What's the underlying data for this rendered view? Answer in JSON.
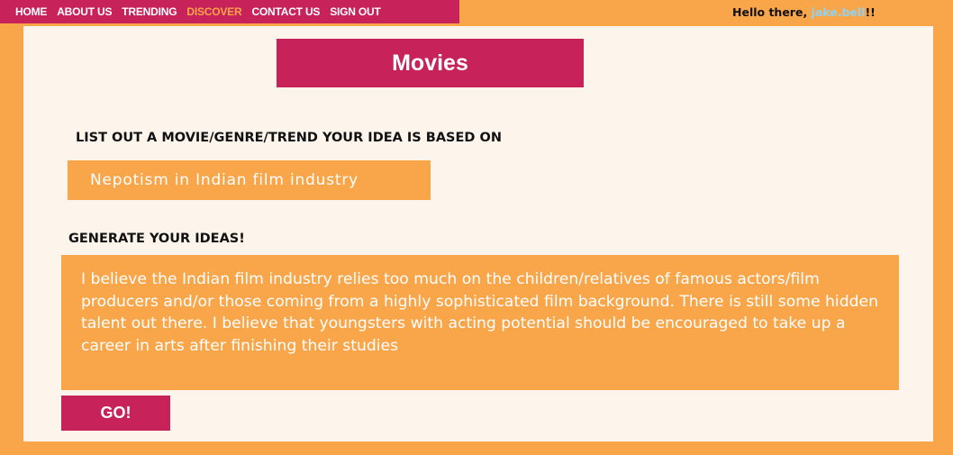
{
  "nav": {
    "items": [
      {
        "label": "HOME"
      },
      {
        "label": "ABOUT US"
      },
      {
        "label": "TRENDING"
      },
      {
        "label": "DISCOVER",
        "active": true
      },
      {
        "label": "CONTACT US"
      },
      {
        "label": "SIGN OUT"
      }
    ]
  },
  "greeting": {
    "prefix": "Hello there, ",
    "username": "jake.bell",
    "suffix": "!!"
  },
  "page": {
    "title": "Movies"
  },
  "form": {
    "basis_label": "LIST OUT A MOVIE/GENRE/TREND YOUR IDEA IS BASED ON",
    "basis_value": "Nepotism in Indian film industry",
    "ideas_label": "GENERATE YOUR IDEAS!",
    "ideas_value": "I believe the Indian film industry relies too much on the children/relatives of famous actors/film producers and/or those coming from a highly sophisticated film background. There is still some hidden talent out there. I believe that youngsters with acting potential should be encouraged to take up a career in arts after finishing their studies",
    "go_label": "GO!"
  },
  "colors": {
    "primary": "#c8225a",
    "accent": "#f9a54a",
    "panel": "#fdf5ec",
    "username": "#8fd3f0"
  }
}
